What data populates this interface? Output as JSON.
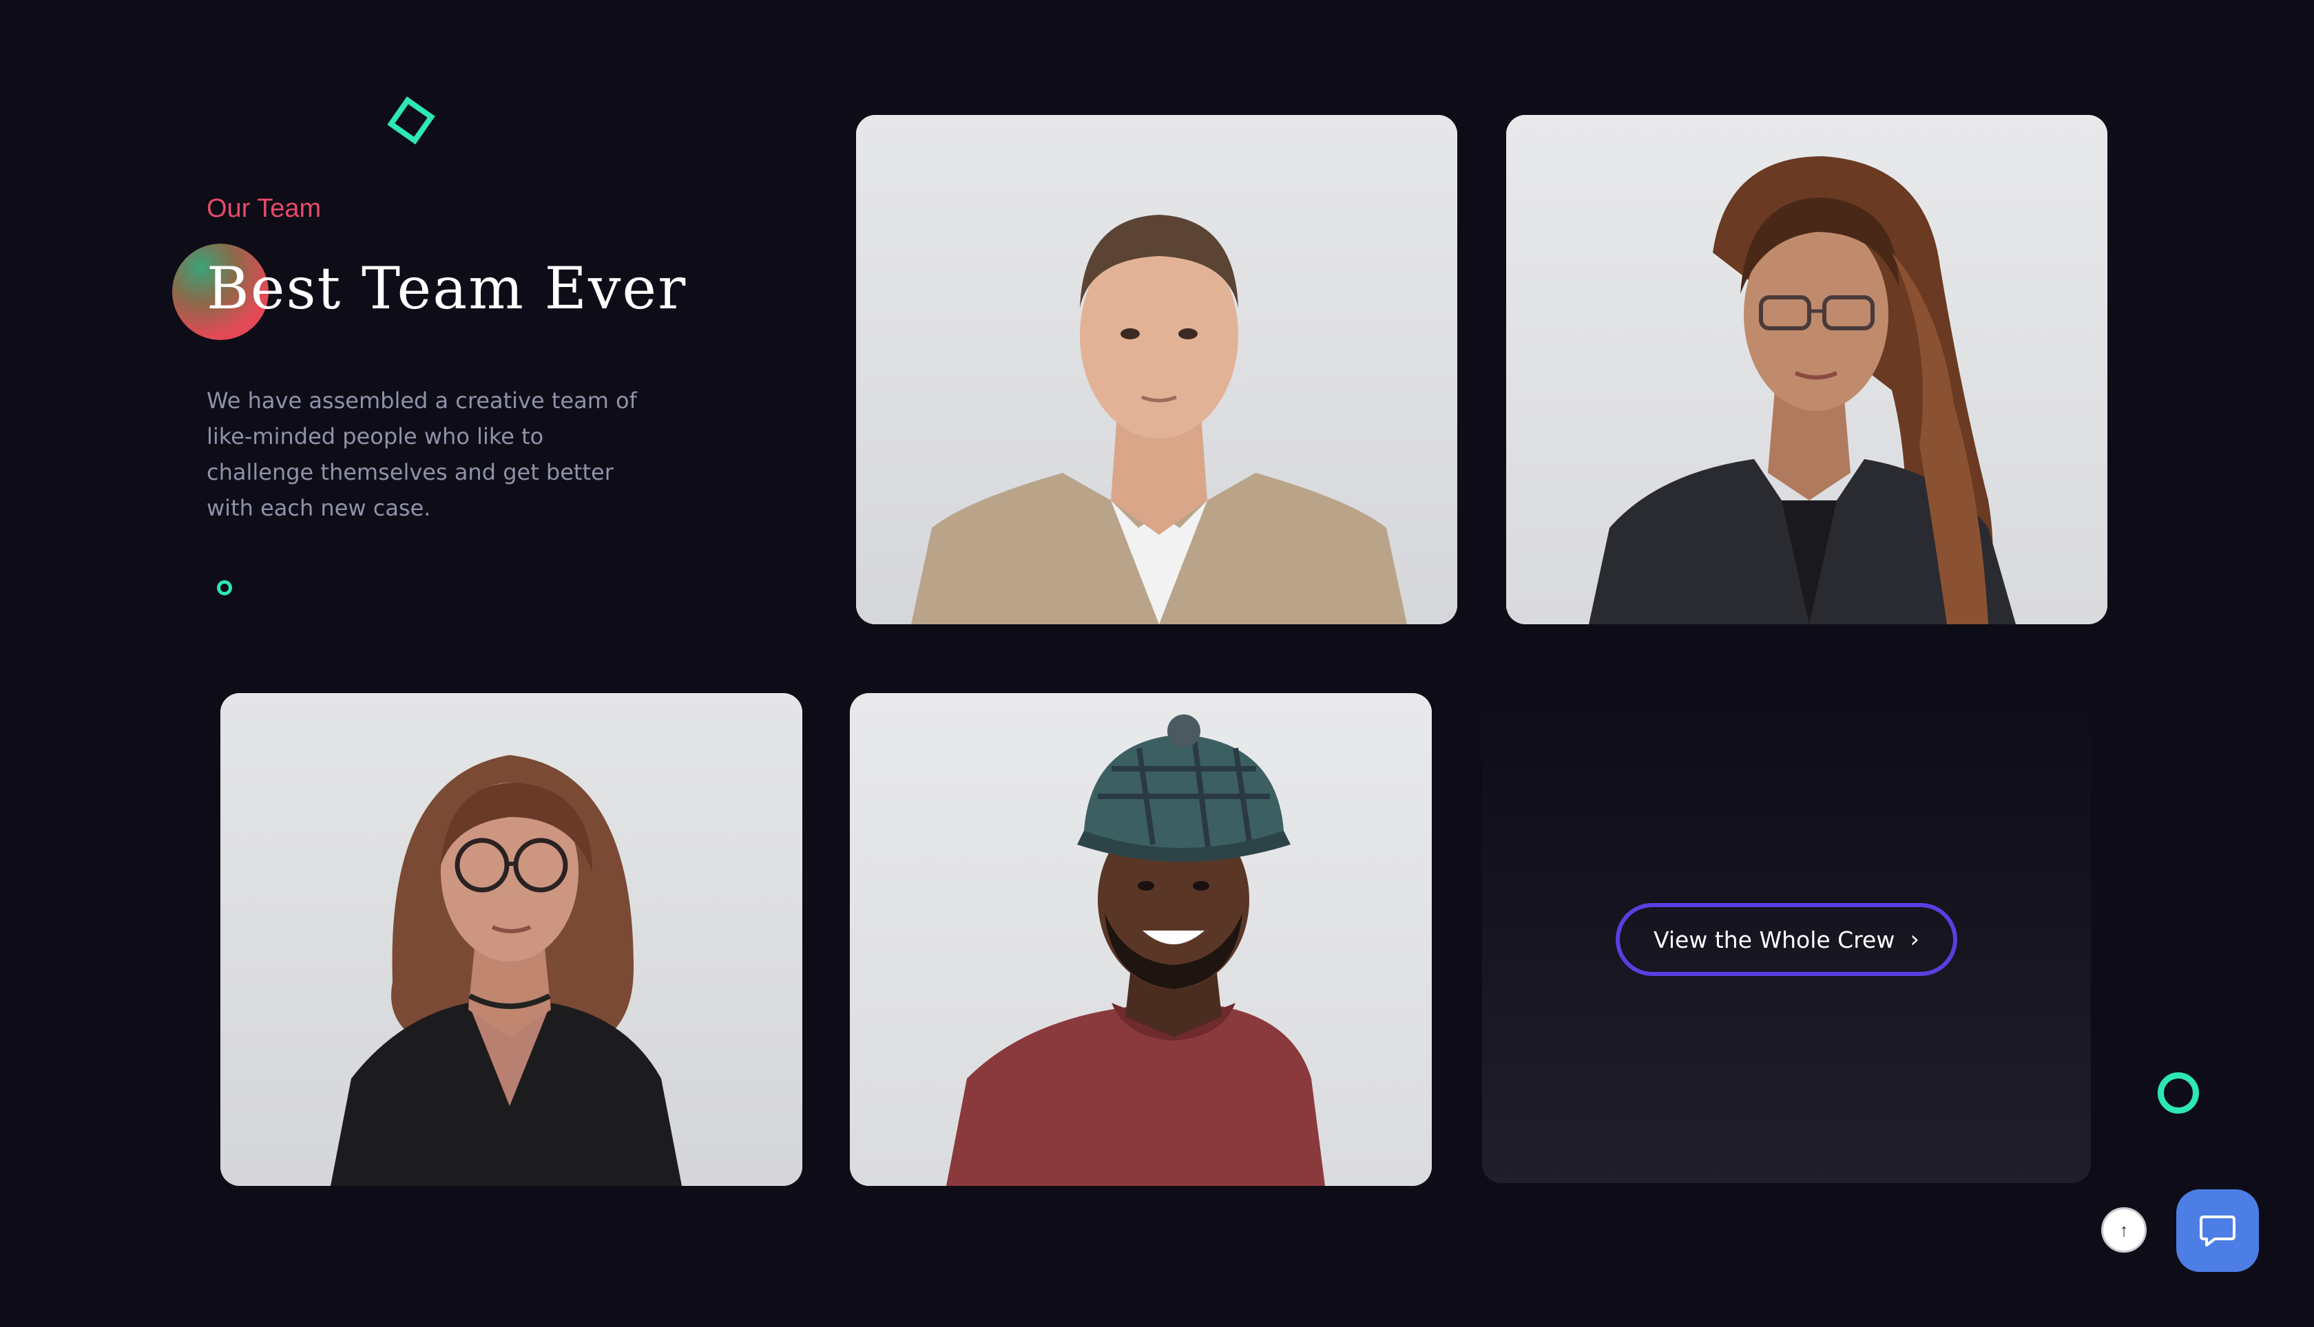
{
  "section": {
    "eyebrow": "Our Team",
    "headline": "Best Team Ever",
    "description": "We have assembled a creative team of like-minded people who like to challenge themselves and get better with each new case."
  },
  "team": [
    {
      "portrait": "young man with short hair in beige shirt"
    },
    {
      "portrait": "woman with long wavy hair and glasses in dark blazer"
    },
    {
      "portrait": "woman with shoulder-length hair and glasses in black top"
    },
    {
      "portrait": "smiling man in plaid cap and red sweater"
    }
  ],
  "cta": {
    "label": "View the Whole Crew",
    "icon": "chevron-right-icon"
  },
  "widgets": {
    "scroll_top_icon": "arrow-up-icon",
    "chat_icon": "chat-bubble-icon"
  },
  "colors": {
    "background": "#0d0c17",
    "accent_pink": "#e84a6a",
    "accent_teal": "#2ee6b6",
    "button_border": "#5a3fe0",
    "chat_blue": "#4c7ee6"
  }
}
